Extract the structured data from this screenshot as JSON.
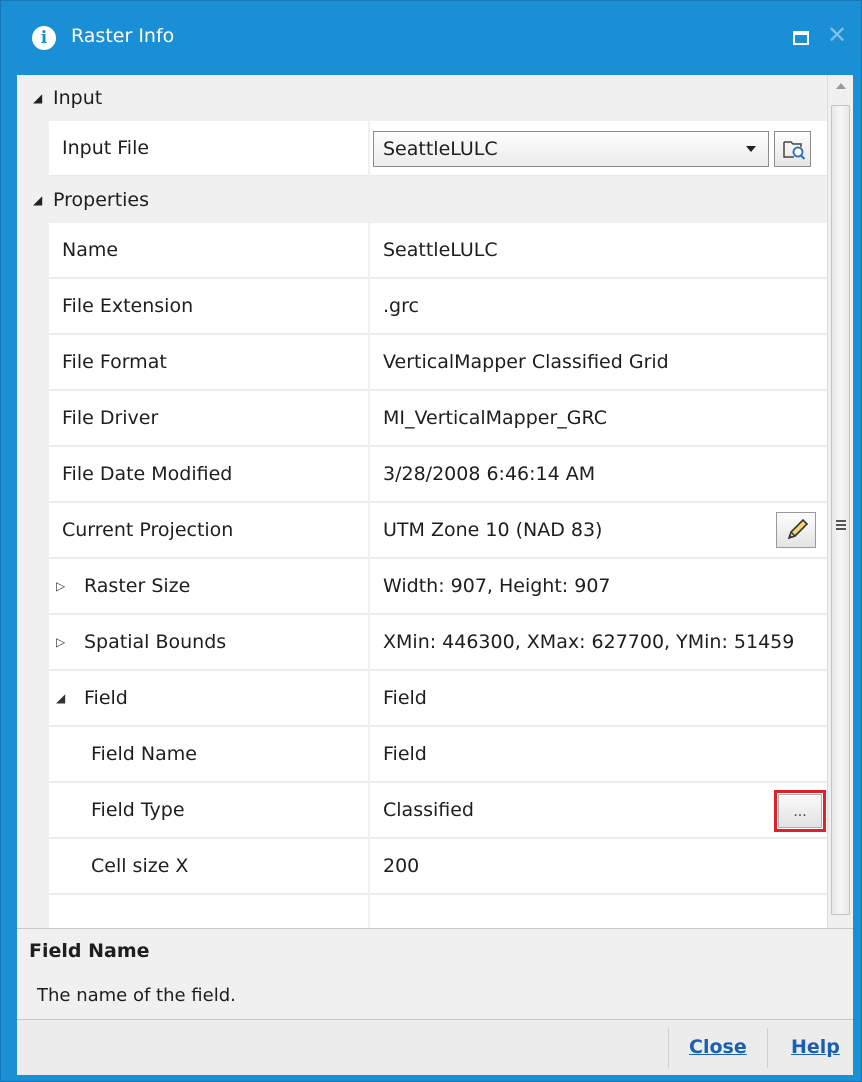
{
  "window": {
    "title": "Raster Info",
    "info_icon": "info-icon",
    "maximize_icon": "maximize-icon",
    "close_icon": "close-icon",
    "close_glyph": "✕",
    "accent_color": "#1a8fd6"
  },
  "input_category": {
    "label": "Input",
    "file_label": "Input File",
    "file_value": "SeattleLULC",
    "browse_icon": "browse-folder-icon"
  },
  "properties_category": {
    "label": "Properties",
    "rows": [
      {
        "name": "Name",
        "value": "SeattleLULC"
      },
      {
        "name": "File Extension",
        "value": ".grc"
      },
      {
        "name": "File Format",
        "value": "VerticalMapper Classified Grid"
      },
      {
        "name": "File Driver",
        "value": "MI_VerticalMapper_GRC"
      },
      {
        "name": "File Date Modified",
        "value": "3/28/2008 6:46:14 AM"
      },
      {
        "name": "Current Projection",
        "value": "UTM Zone 10 (NAD 83)",
        "button_icon": "pencil-icon"
      },
      {
        "name": "Raster Size",
        "value": "Width: 907, Height: 907"
      },
      {
        "name": "Spatial Bounds",
        "value": "XMin: 446300, XMax: 627700, YMin: 51459"
      },
      {
        "name": "Field",
        "value": "Field"
      },
      {
        "name": "Field Name",
        "value": "Field"
      },
      {
        "name": "Field Type",
        "value": "Classified",
        "button_label": "..."
      },
      {
        "name": "Cell size X",
        "value": "200"
      }
    ]
  },
  "description": {
    "title": "Field Name",
    "text": "The name of the field."
  },
  "footer": {
    "close_label": "Close",
    "help_label": "Help"
  },
  "highlight_color": "#e0202a"
}
